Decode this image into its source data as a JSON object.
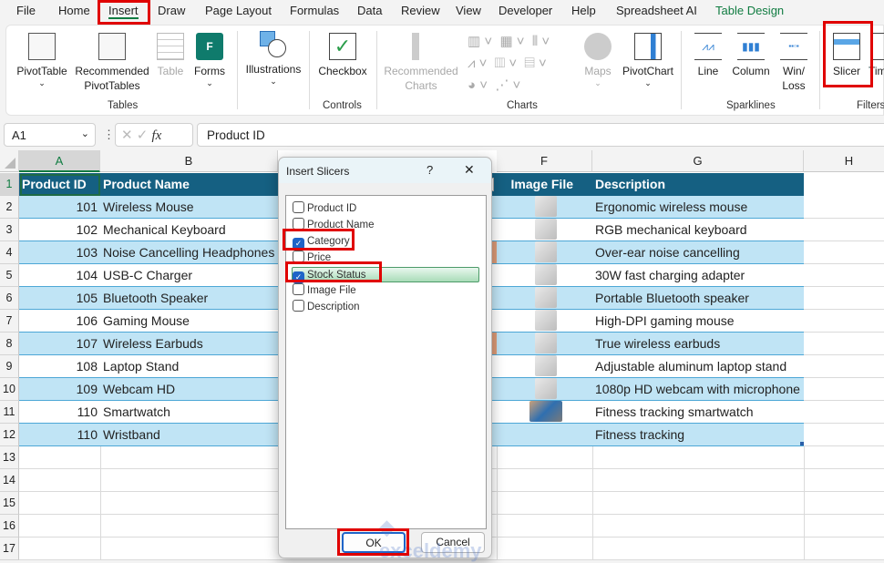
{
  "menu_tabs": [
    "File",
    "Home",
    "Insert",
    "Draw",
    "Page Layout",
    "Formulas",
    "Data",
    "Review",
    "View",
    "Developer",
    "Help",
    "Spreadsheet AI",
    "Table Design"
  ],
  "active_tab": "Insert",
  "ribbon": {
    "tables": {
      "label": "Tables",
      "pivottable": "PivotTable",
      "recommended_pivot": "Recommended PivotTables",
      "table": "Table",
      "forms": "Forms"
    },
    "illustrations": "Illustrations",
    "controls": {
      "label": "Controls",
      "checkbox": "Checkbox"
    },
    "charts": {
      "label": "Charts",
      "recommended": "Recommended Charts",
      "maps": "Maps",
      "pivotchart": "PivotChart"
    },
    "sparklines": {
      "label": "Sparklines",
      "line": "Line",
      "column": "Column",
      "winloss": "Win/ Loss"
    },
    "filters": {
      "label": "Filters",
      "slicer": "Slicer",
      "timeline": "Tim"
    }
  },
  "formula_bar": {
    "name_box": "A1",
    "fx": "fx",
    "content": "Product ID"
  },
  "columns": [
    "A",
    "B",
    "F",
    "G",
    "H"
  ],
  "rows": [
    "1",
    "2",
    "3",
    "4",
    "5",
    "6",
    "7",
    "8",
    "9",
    "10",
    "11",
    "12",
    "13",
    "14",
    "15",
    "16",
    "17"
  ],
  "table": {
    "headers": [
      "Product ID",
      "Product Name",
      "Image File",
      "Description"
    ],
    "rows": [
      {
        "id": "101",
        "name": "Wireless Mouse",
        "desc": "Ergonomic wireless mouse"
      },
      {
        "id": "102",
        "name": "Mechanical Keyboard",
        "desc": "RGB mechanical keyboard"
      },
      {
        "id": "103",
        "name": "Noise Cancelling Headphones",
        "desc": "Over-ear noise cancelling"
      },
      {
        "id": "104",
        "name": "USB-C Charger",
        "desc": "30W fast charging adapter"
      },
      {
        "id": "105",
        "name": "Bluetooth Speaker",
        "desc": "Portable Bluetooth speaker"
      },
      {
        "id": "106",
        "name": "Gaming Mouse",
        "desc": "High-DPI gaming mouse"
      },
      {
        "id": "107",
        "name": "Wireless Earbuds",
        "desc": "True wireless earbuds"
      },
      {
        "id": "108",
        "name": "Laptop Stand",
        "desc": "Adjustable aluminum laptop stand"
      },
      {
        "id": "109",
        "name": "Webcam HD",
        "desc": "1080p HD webcam with microphone"
      },
      {
        "id": "110",
        "name": "Smartwatch",
        "desc": "Fitness tracking smartwatch"
      },
      {
        "id": "110",
        "name": "Wristband",
        "desc": "Fitness tracking"
      }
    ]
  },
  "dialog": {
    "title": "Insert Slicers",
    "help": "?",
    "close": "✕",
    "fields": [
      {
        "label": "Product ID",
        "checked": false
      },
      {
        "label": "Product Name",
        "checked": false
      },
      {
        "label": "Category",
        "checked": true
      },
      {
        "label": "Price",
        "checked": false
      },
      {
        "label": "Stock Status",
        "checked": true
      },
      {
        "label": "Image File",
        "checked": false
      },
      {
        "label": "Description",
        "checked": false
      }
    ],
    "ok": "OK",
    "cancel": "Cancel"
  },
  "watermark": "exceldemy",
  "colors": {
    "header": "#156082",
    "band": "#c0e4f5",
    "highlight": "#e00000",
    "accent_tab": "#107c41"
  }
}
